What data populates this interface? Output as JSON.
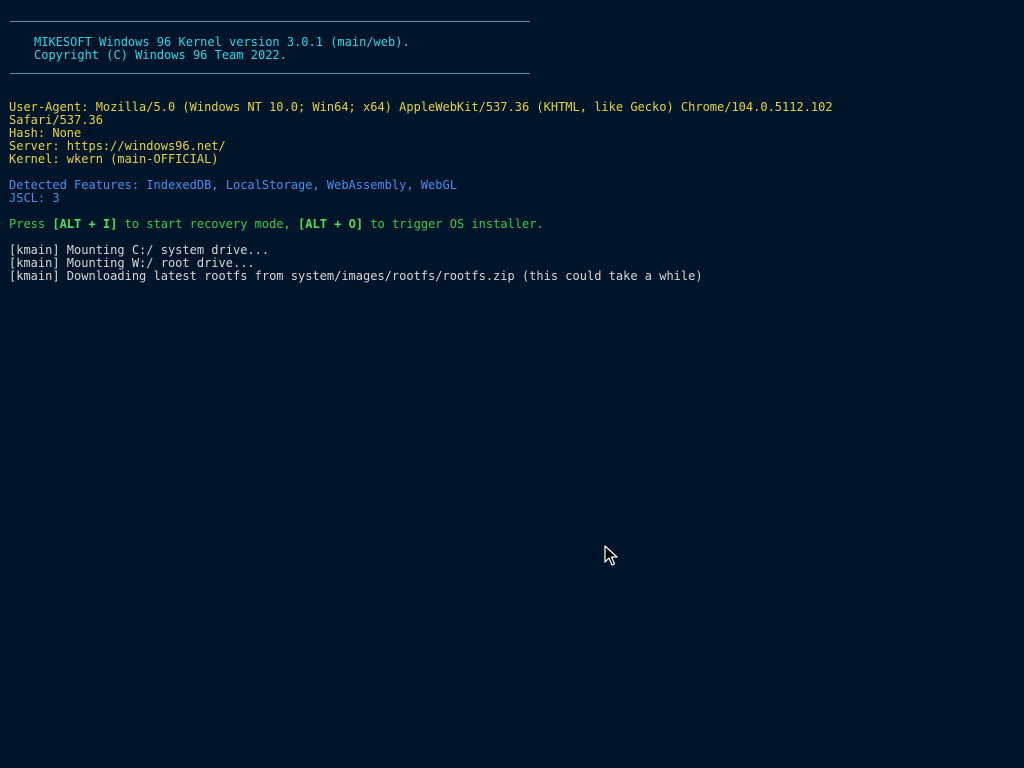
{
  "banner": {
    "line1": "MIKESOFT Windows 96 Kernel version 3.0.1 (main/web).",
    "line2": "Copyright (C) Windows 96 Team 2022."
  },
  "env": {
    "user_agent_1": "User-Agent: Mozilla/5.0 (Windows NT 10.0; Win64; x64) AppleWebKit/537.36 (KHTML, like Gecko) Chrome/104.0.5112.102",
    "user_agent_2": "Safari/537.36",
    "hash": "Hash: None",
    "server": "Server: https://windows96.net/",
    "kernel": "Kernel: wkern (main-OFFICIAL)"
  },
  "features": {
    "detected": "Detected Features: IndexedDB, LocalStorage, WebAssembly, WebGL",
    "jscl": "JSCL: 3"
  },
  "prompt": {
    "press": "Press ",
    "key1": "[ALT + I]",
    "mid": " to start recovery mode, ",
    "key2": "[ALT + O]",
    "end": " to trigger OS installer."
  },
  "log": [
    "[kmain] Mounting C:/ system drive...",
    "[kmain] Mounting W:/ root drive...",
    "[kmain] Downloading latest rootfs from system/images/rootfs/rootfs.zip (this could take a while)"
  ],
  "colors": {
    "background": "#001529",
    "banner": "#2fd4ea",
    "env": "#e8d23a",
    "features": "#4c8cf0",
    "prompt": "#3ac94a",
    "log": "#d6d6d6"
  },
  "icons": {
    "cursor": "mouse-pointer-icon"
  }
}
